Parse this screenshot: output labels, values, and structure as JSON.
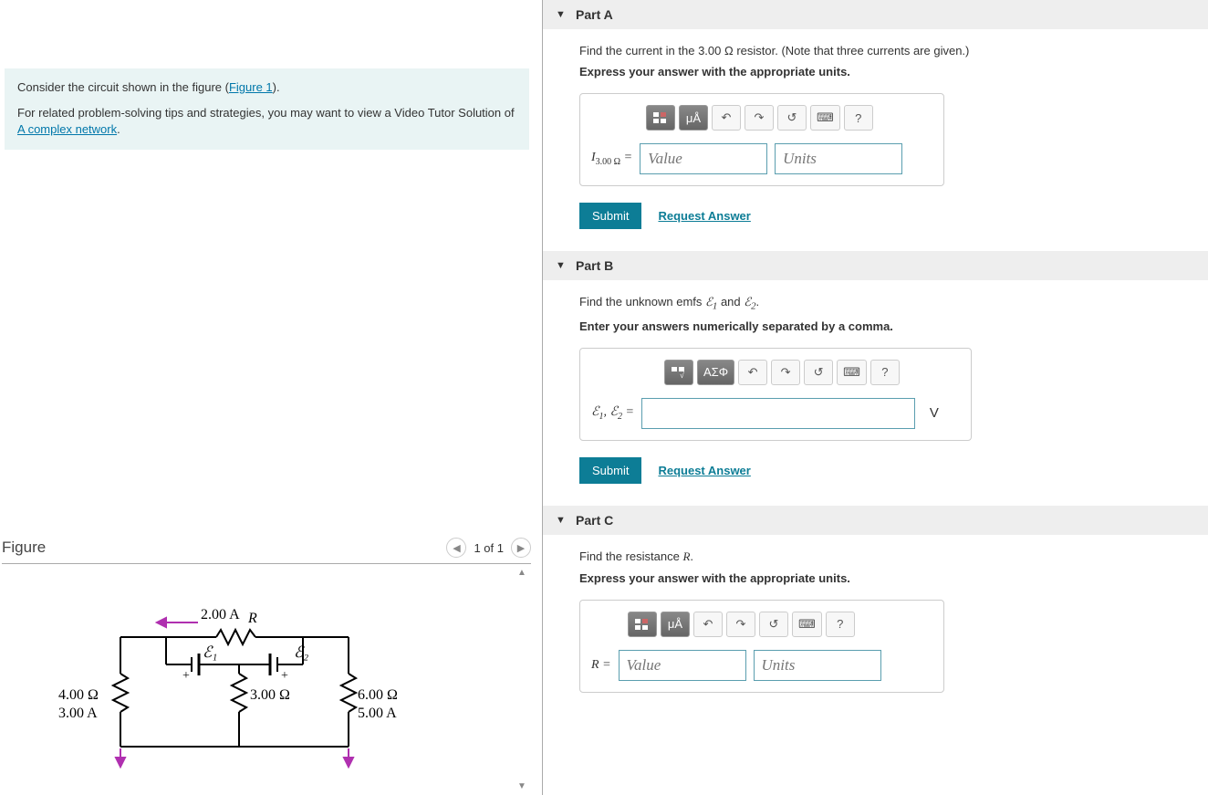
{
  "prompt": {
    "line1_a": "Consider the circuit shown in the figure (",
    "figure_link": "Figure 1",
    "line1_b": ").",
    "line2": "For related problem-solving tips and strategies, you may want to view a Video Tutor Solution of ",
    "link2": "A complex network"
  },
  "figure": {
    "title": "Figure",
    "counter": "1 of 1",
    "labels": {
      "i_top": "2.00 A",
      "r_top": "R",
      "e1": "ℰ₁",
      "e2": "ℰ₂",
      "r_left": "4.00 Ω",
      "i_left": "3.00 A",
      "r_mid": "3.00 Ω",
      "r_right": "6.00 Ω",
      "i_right": "5.00 A"
    }
  },
  "parts": {
    "a": {
      "header": "Part A",
      "question": "Find the current in the 3.00 Ω resistor. (Note that three currents are given.)",
      "instruction": "Express your answer with the appropriate units.",
      "label_html": "I<sub>3.00 Ω</sub> ="
    },
    "b": {
      "header": "Part B",
      "question_a": "Find the unknown emfs ",
      "question_b": " and ",
      "instruction": "Enter your answers numerically separated by a comma.",
      "label_text": "ℰ₁, ℰ₂ =",
      "unit": "V"
    },
    "c": {
      "header": "Part C",
      "question_a": "Find the resistance ",
      "instruction": "Express your answer with the appropriate units.",
      "label_html": "R ="
    }
  },
  "common": {
    "value_ph": "Value",
    "units_ph": "Units",
    "submit": "Submit",
    "request": "Request Answer",
    "mu_a": "μÅ",
    "greek": "ΑΣΦ",
    "help": "?"
  }
}
